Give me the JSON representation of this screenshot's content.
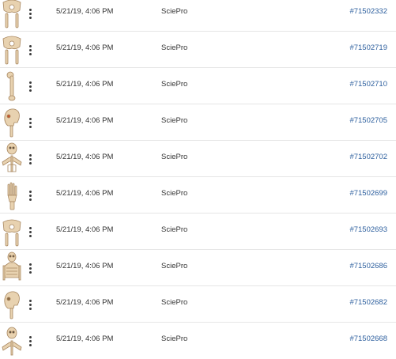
{
  "rows": [
    {
      "thumbnail_icon": "pelvis-icon",
      "date": "5/21/19, 4:06 PM",
      "source": "SciePro",
      "id": "#71502332"
    },
    {
      "thumbnail_icon": "pelvis-icon",
      "date": "5/21/19, 4:06 PM",
      "source": "SciePro",
      "id": "#71502719"
    },
    {
      "thumbnail_icon": "femur-icon",
      "date": "5/21/19, 4:06 PM",
      "source": "SciePro",
      "id": "#71502710"
    },
    {
      "thumbnail_icon": "skull-side-icon",
      "date": "5/21/19, 4:06 PM",
      "source": "SciePro",
      "id": "#71502705"
    },
    {
      "thumbnail_icon": "skeleton-torso-icon",
      "date": "5/21/19, 4:06 PM",
      "source": "SciePro",
      "id": "#71502702"
    },
    {
      "thumbnail_icon": "hand-bones-icon",
      "date": "5/21/19, 4:06 PM",
      "source": "SciePro",
      "id": "#71502699"
    },
    {
      "thumbnail_icon": "pelvis-icon",
      "date": "5/21/19, 4:06 PM",
      "source": "SciePro",
      "id": "#71502693"
    },
    {
      "thumbnail_icon": "skeleton-torso-icon",
      "date": "5/21/19, 4:06 PM",
      "source": "SciePro",
      "id": "#71502686"
    },
    {
      "thumbnail_icon": "skull-side-icon",
      "date": "5/21/19, 4:06 PM",
      "source": "SciePro",
      "id": "#71502682"
    },
    {
      "thumbnail_icon": "skeleton-torso-icon",
      "date": "5/21/19, 4:06 PM",
      "source": "SciePro",
      "id": "#71502668"
    }
  ],
  "colors": {
    "link": "#2d5f9e",
    "bone": "#e8d2b0",
    "divider": "#e6e6e6"
  }
}
